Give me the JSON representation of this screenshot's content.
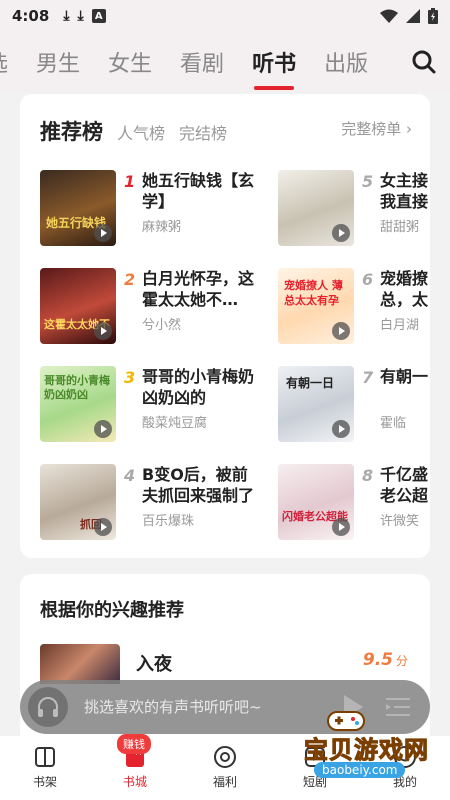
{
  "status_bar": {
    "time": "4:08",
    "notif_a": "A"
  },
  "top_tabs": {
    "items": [
      {
        "label": "选"
      },
      {
        "label": "男生"
      },
      {
        "label": "女生"
      },
      {
        "label": "看剧"
      },
      {
        "label": "听书",
        "active": true
      },
      {
        "label": "出版"
      }
    ],
    "search_icon": "search-icon"
  },
  "ranking": {
    "title": "推荐榜",
    "tab_popular": "人气榜",
    "tab_finished": "完结榜",
    "full_list": "完整榜单 ›",
    "books": [
      {
        "rank": "1",
        "title": "她五行缺钱【玄学】",
        "author": "麻辣粥",
        "rank_color": "#e5232f"
      },
      {
        "rank": "2",
        "title": "白月光怀孕，这霍太太她不…",
        "author": "兮小然",
        "rank_color": "#f07b3f"
      },
      {
        "rank": "3",
        "title": "哥哥的小青梅奶凶奶凶的",
        "author": "酸菜炖豆腐",
        "rank_color": "#f5b800"
      },
      {
        "rank": "4",
        "title": "B变O后，被前夫抓回来强制了",
        "author": "百乐爆珠",
        "rank_color": "#aaaaaa"
      },
      {
        "rank": "5",
        "title": "女主接我直接",
        "author": "甜甜粥",
        "rank_color": "#aaaaaa"
      },
      {
        "rank": "6",
        "title": "宠婚撩总，太",
        "author": "白月湖",
        "rank_color": "#aaaaaa"
      },
      {
        "rank": "7",
        "title": "有朝一",
        "author": "霍临",
        "rank_color": "#aaaaaa"
      },
      {
        "rank": "8",
        "title": "千亿盛老公超",
        "author": "许微笑",
        "rank_color": "#aaaaaa"
      }
    ],
    "cover_texts": [
      "她五行缺钱",
      "这霍太太她不",
      "哥哥的小青梅奶凶奶凶",
      "抓回",
      "",
      "宠婚撩人 薄总太太有孕",
      "有朝一日",
      "闪婚老公超能"
    ]
  },
  "interest": {
    "title": "根据你的兴趣推荐",
    "book_title": "入夜",
    "score": "9.5",
    "score_unit": "分"
  },
  "player": {
    "placeholder": "挑选喜欢的有声书听听吧~"
  },
  "bottom_nav": {
    "items": [
      {
        "label": "书架"
      },
      {
        "label": "书城",
        "active": true
      },
      {
        "label": "福利"
      },
      {
        "label": "短剧"
      },
      {
        "label": "我的"
      }
    ],
    "badge": "赚钱"
  },
  "watermark": {
    "text": "宝贝游戏网",
    "url": "baobeiy.com"
  },
  "colors": {
    "accent": "#e5232f",
    "score": "#f07b3f",
    "muted": "#999999"
  }
}
